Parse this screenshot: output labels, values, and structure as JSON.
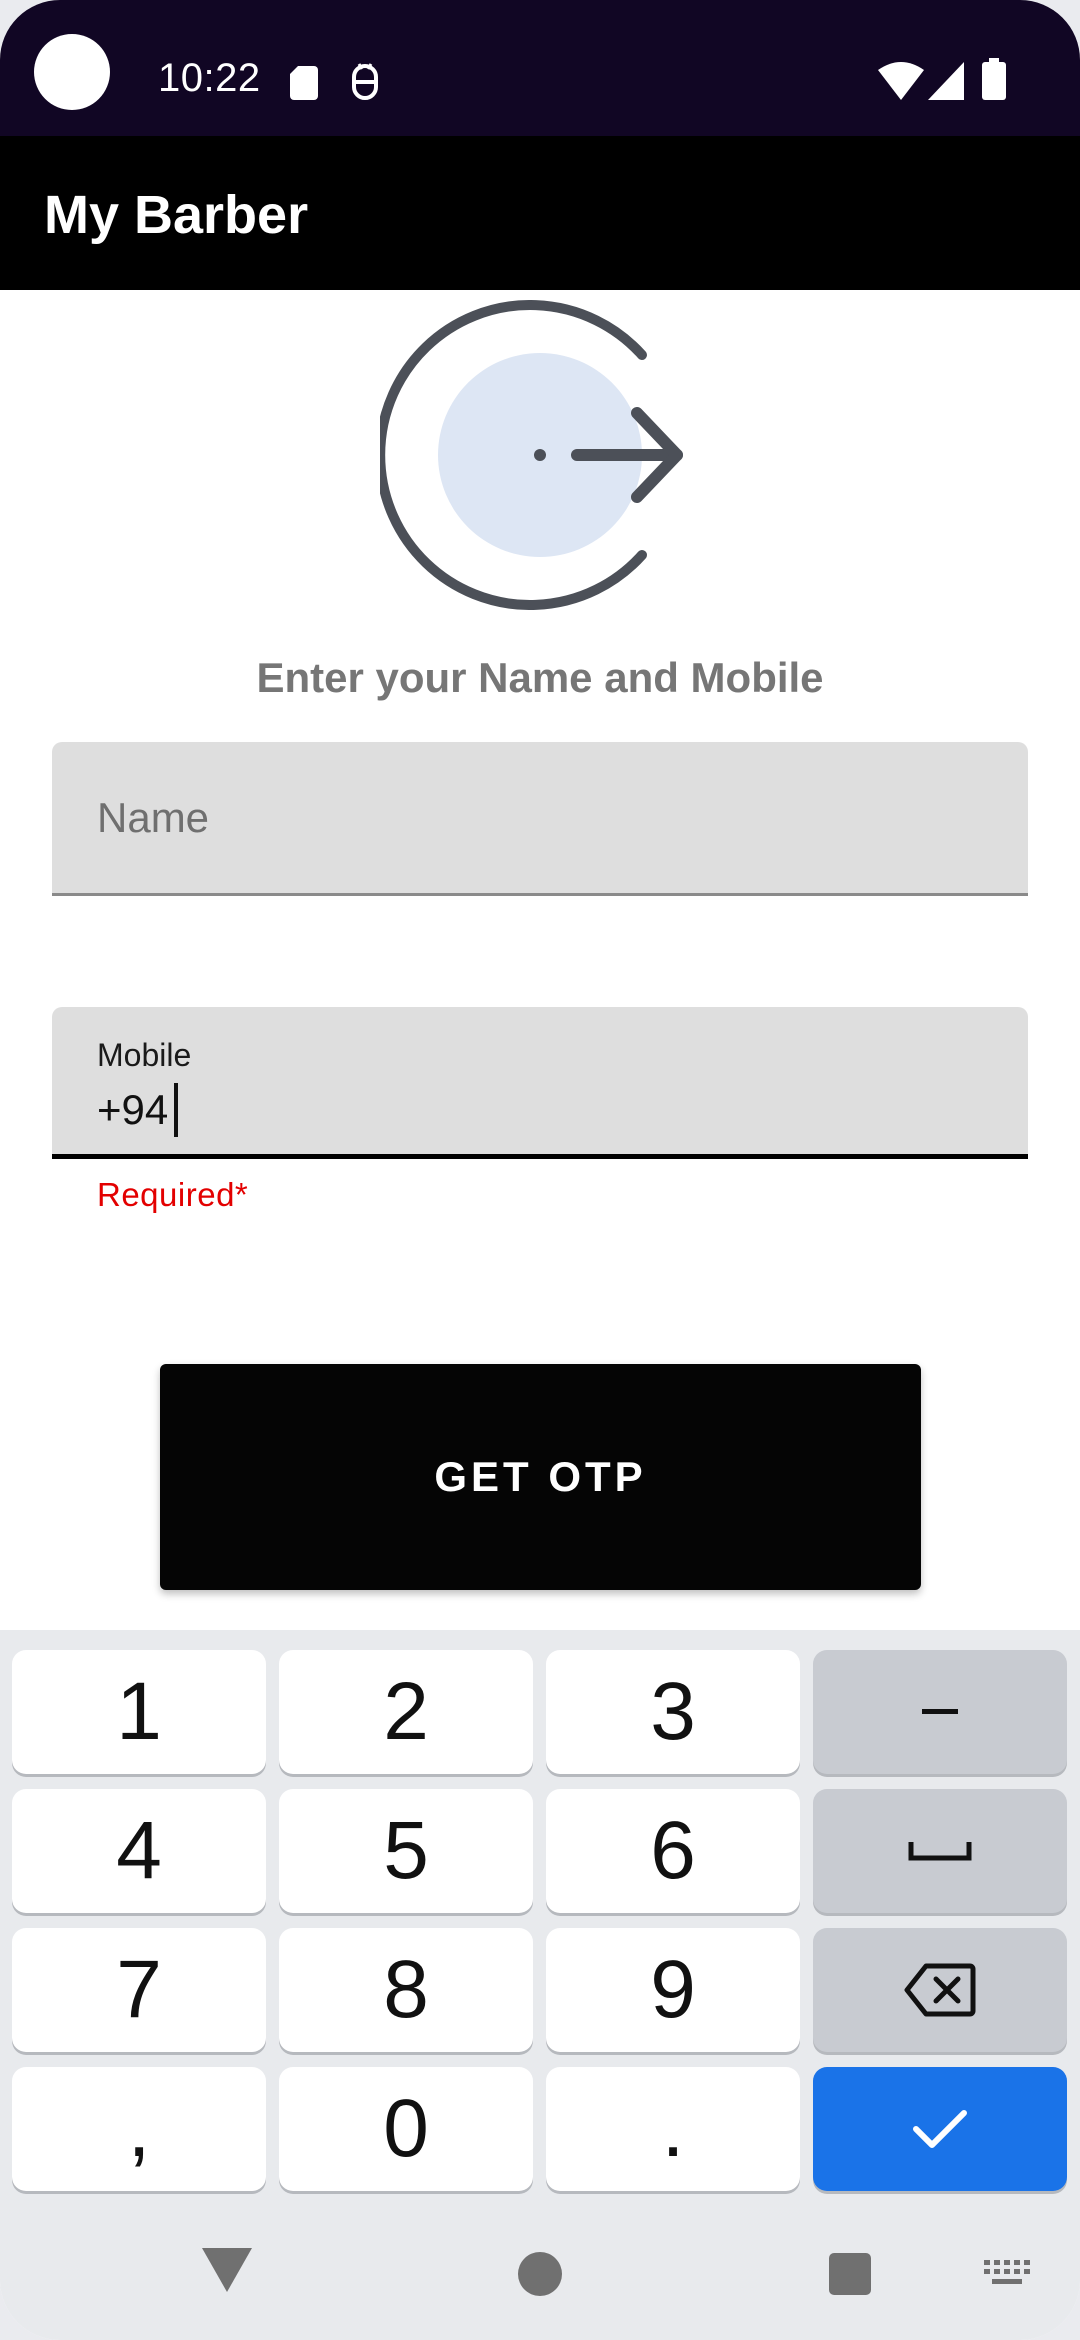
{
  "status_bar": {
    "time": "10:22",
    "icons": [
      "sd-card-icon",
      "accessibility-icon",
      "wifi-icon",
      "signal-icon",
      "battery-icon"
    ]
  },
  "app_bar": {
    "title": "My Barber"
  },
  "hero": {
    "icon": "login-icon"
  },
  "prompt": "Enter your Name and Mobile",
  "form": {
    "name": {
      "placeholder": "Name",
      "value": ""
    },
    "mobile": {
      "label": "Mobile",
      "value": "+94",
      "error": "Required*"
    }
  },
  "otp_button": {
    "label": "GET OTP"
  },
  "keyboard": {
    "keys": [
      "1",
      "2",
      "3",
      "–",
      "4",
      "5",
      "6",
      "␣",
      "7",
      "8",
      "9",
      "⌫",
      ",",
      "0",
      ".",
      "✓"
    ],
    "enter_color": "#1a73e8"
  },
  "nav_bar": {
    "icons": [
      "back-icon",
      "home-icon",
      "recents-icon",
      "keyboard-switch-icon"
    ]
  },
  "colors": {
    "app_bar": "#000000",
    "status_bar": "#110624",
    "error": "#e30000",
    "button": "#050505"
  }
}
